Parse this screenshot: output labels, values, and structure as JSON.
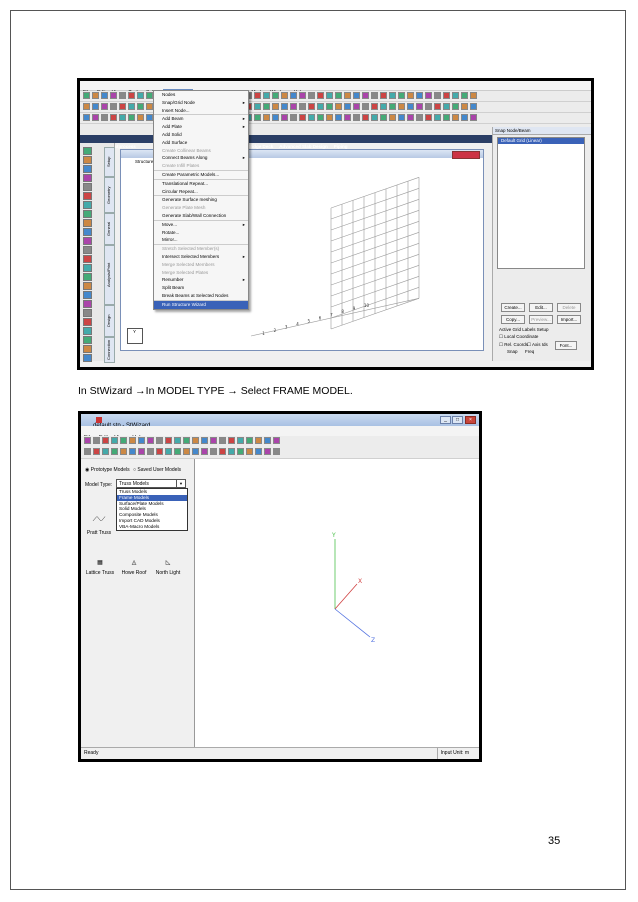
{
  "page_number": "35",
  "caption": {
    "text": "In StWizard →In MODEL TYPE → Select FRAME MODEL."
  },
  "staad": {
    "menubar": [
      "File",
      "Edit",
      "View",
      "Tools",
      "Select",
      "Geometry",
      "Commands",
      "Analyze",
      "Mode",
      "Window",
      "Help"
    ],
    "active_menu_index": 5,
    "tabs": [
      "Modeling",
      "Postprocess",
      "",
      "SW Connection",
      "Bridge Deck",
      "Advanced Slab Design",
      "Piping"
    ],
    "view_title": "Structure1.st",
    "left_tabs": [
      "Setup",
      "Geometry",
      "General",
      "Analysis/Print",
      "Design",
      "Connection"
    ],
    "geometry_menu": [
      {
        "label": "Nodes",
        "state": "normal",
        "submenu": false,
        "sep": false
      },
      {
        "label": "Snap/Grid Node",
        "state": "normal",
        "submenu": true,
        "sep": false
      },
      {
        "label": "Insert Node...",
        "state": "normal",
        "submenu": false,
        "sep": false
      },
      {
        "label": "Add Beam",
        "state": "normal",
        "submenu": true,
        "sep": true
      },
      {
        "label": "Add Plate",
        "state": "normal",
        "submenu": true,
        "sep": false
      },
      {
        "label": "Add Solid",
        "state": "normal",
        "submenu": false,
        "sep": false
      },
      {
        "label": "Add Surface",
        "state": "normal",
        "submenu": false,
        "sep": false
      },
      {
        "label": "Create Collinear Beams",
        "state": "disabled",
        "submenu": false,
        "sep": false
      },
      {
        "label": "Connect Beams Along",
        "state": "normal",
        "submenu": true,
        "sep": false
      },
      {
        "label": "Create Infill Plates",
        "state": "disabled",
        "submenu": false,
        "sep": false
      },
      {
        "label": "Create Parametric Models...",
        "state": "normal",
        "submenu": false,
        "sep": true
      },
      {
        "label": "Translational Repeat...",
        "state": "normal",
        "submenu": false,
        "sep": true
      },
      {
        "label": "Circular Repeat...",
        "state": "normal",
        "submenu": false,
        "sep": false
      },
      {
        "label": "Generate Surface meshing",
        "state": "normal",
        "submenu": false,
        "sep": true
      },
      {
        "label": "Generate Plate Mesh",
        "state": "disabled",
        "submenu": false,
        "sep": false
      },
      {
        "label": "Generate Slab/Wall Connection",
        "state": "normal",
        "submenu": false,
        "sep": false
      },
      {
        "label": "Move...",
        "state": "normal",
        "submenu": true,
        "sep": true
      },
      {
        "label": "Rotate...",
        "state": "normal",
        "submenu": false,
        "sep": false
      },
      {
        "label": "Mirror...",
        "state": "normal",
        "submenu": false,
        "sep": false
      },
      {
        "label": "Stretch Selected Member(s)",
        "state": "disabled",
        "submenu": false,
        "sep": true
      },
      {
        "label": "Intersect Selected Members",
        "state": "normal",
        "submenu": true,
        "sep": false
      },
      {
        "label": "Merge Selected Members",
        "state": "disabled",
        "submenu": false,
        "sep": false
      },
      {
        "label": "Merge Selected Plates",
        "state": "disabled",
        "submenu": false,
        "sep": false
      },
      {
        "label": "Renumber",
        "state": "normal",
        "submenu": true,
        "sep": false
      },
      {
        "label": "Split Beam",
        "state": "normal",
        "submenu": false,
        "sep": false
      },
      {
        "label": "Break Beams at Selected Nodes",
        "state": "normal",
        "submenu": false,
        "sep": false
      },
      {
        "label": "Run Structure Wizard",
        "state": "highlighted",
        "submenu": false,
        "sep": true
      }
    ],
    "right_panel": {
      "title": "Snap Node/Beam",
      "list_item": "Default Grid (Linear)",
      "buttons": [
        "Create...",
        "Edit...",
        "Delete",
        "Copy...",
        "Preview...",
        "Import..."
      ],
      "grid_labels_title": "Active Grid Labels Setup",
      "options": [
        "Local Coordinate",
        "Rel. Coords",
        "Axis Ids",
        "Font..."
      ],
      "footer": [
        "Snap",
        "Freq"
      ]
    }
  },
  "wizard": {
    "title": "default.stp - StWizard",
    "menu": [
      "File",
      "Edit",
      "View",
      "Help"
    ],
    "radio_prototype": "Prototype Models",
    "radio_saved": "Saved User Models",
    "model_type_label": "Model Type:",
    "model_type_value": "Truss Models",
    "options": [
      "Truss Models",
      "Frame Models",
      "Surface/Plate Models",
      "Solid Models",
      "Composite Models",
      "Import CAD Models",
      "VBA-Macro Models"
    ],
    "highlighted_index": 1,
    "models": [
      "Pratt Truss",
      "Lattice Truss",
      "Howe Roof",
      "North Light"
    ],
    "axes": [
      "Y",
      "X",
      "Z"
    ],
    "status_left": "Ready",
    "status_right": "Input Unit: m"
  }
}
